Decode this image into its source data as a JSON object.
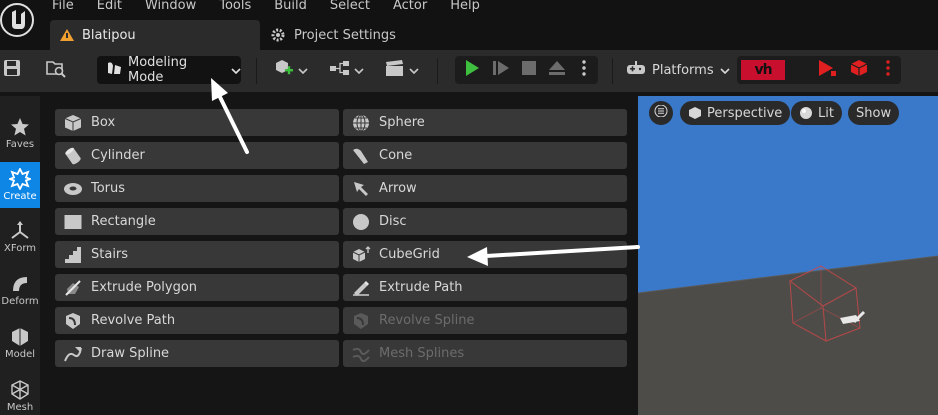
{
  "menu": [
    "File",
    "Edit",
    "Window",
    "Tools",
    "Build",
    "Select",
    "Actor",
    "Help"
  ],
  "tabs": {
    "active": "Blatipou",
    "project_settings": "Project Settings"
  },
  "toolbar": {
    "mode_label": "Modeling Mode",
    "platforms_label": "Platforms",
    "vh_label": "vh"
  },
  "nav": [
    {
      "label": "Faves",
      "icon": "star-icon"
    },
    {
      "label": "Create",
      "icon": "create-icon"
    },
    {
      "label": "XForm",
      "icon": "xform-icon"
    },
    {
      "label": "Deform",
      "icon": "deform-icon"
    },
    {
      "label": "Model",
      "icon": "model-icon"
    },
    {
      "label": "Mesh",
      "icon": "mesh-icon"
    }
  ],
  "tools": {
    "left": [
      "Box",
      "Cylinder",
      "Torus",
      "Rectangle",
      "Stairs",
      "Extrude Polygon",
      "Revolve Path",
      "Draw Spline"
    ],
    "right": [
      "Sphere",
      "Cone",
      "Arrow",
      "Disc",
      "CubeGrid",
      "Extrude Path",
      "Revolve Spline",
      "Mesh Splines"
    ]
  },
  "viewport": {
    "perspective": "Perspective",
    "lit": "Lit",
    "show": "Show"
  },
  "colors": {
    "accent": "#0e86e6",
    "play": "#3fbf3f",
    "brand_red": "#c8102e"
  }
}
